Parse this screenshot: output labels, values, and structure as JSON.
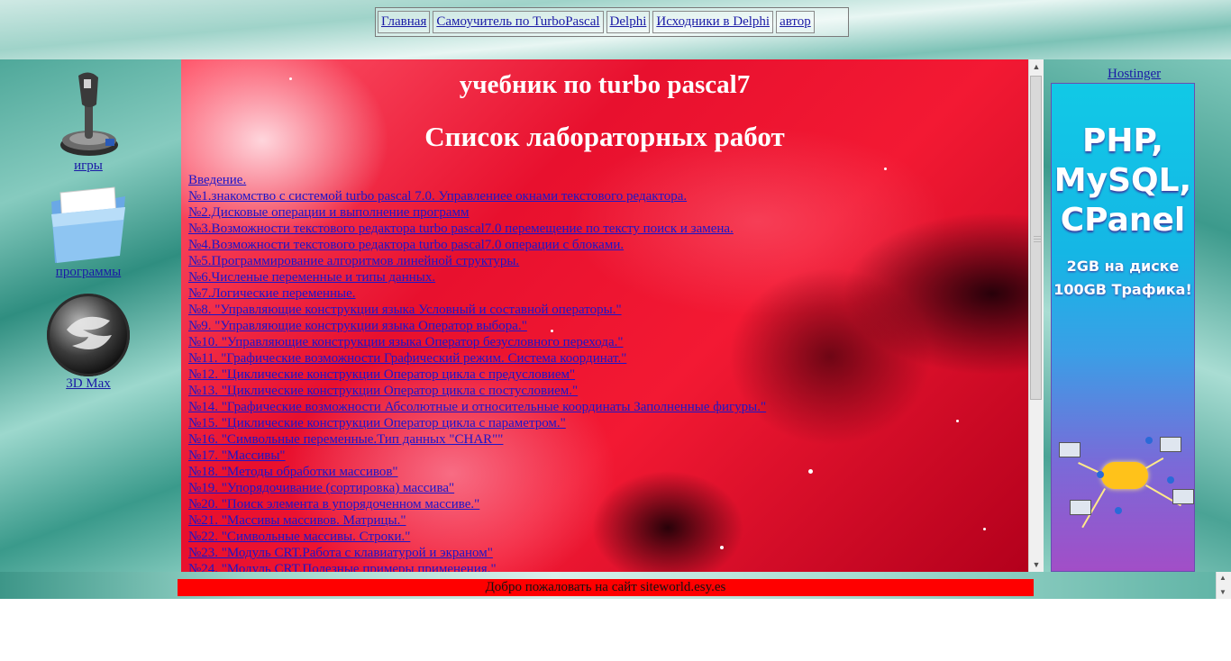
{
  "nav": {
    "items": [
      "Главная",
      "Самоучитель по TurboPascal",
      "Delphi",
      "Исходники в Delphi",
      "автор"
    ]
  },
  "sidebar": {
    "items": [
      {
        "label": "игры",
        "icon": "joystick-icon"
      },
      {
        "label": "программы",
        "icon": "folder-icon"
      },
      {
        "label": "3D Max",
        "icon": "3dmax-logo-icon"
      }
    ]
  },
  "main": {
    "title": "учебник по turbo pascal7",
    "subtitle": "Список лабораторных работ",
    "labs": [
      "Введение.",
      "№1.знакомство с системой turbo pascal 7.0. Управлениее окнами текстового редактора.",
      "№2.Дисковые операции и выполнение программ",
      "№3.Возможности текстового редактора turbo pascal7.0 перемещение по тексту поиск и замена.",
      "№4.Возможности текстового редактора turbo pascal7.0 операции с блоками.",
      "№5.Программирование алгоритмов линейной структуры.",
      "№6.Численые переменные и типы данных.",
      "№7.Логические переменные.",
      "№8. \"Управляющие конструкции языка Условный и составной операторы.\"",
      "№9. \"Управляющие конструкции языка Оператор выбора.\"",
      "№10. \"Управляющие конструкции языка Оператор безусловного перехода.\"",
      "№11. \"Графические возможности Графический режим. Система координат.\"",
      "№12. \"Циклические конструкции Оператор цикла с предусловием\"",
      "№13. \"Циклические конструкции Оператор цикла с постусловием.\"",
      "№14. \"Графические возможности Абсолютные и относительные координаты Заполненные фигуры.\"",
      "№15. \"Циклические конструкции Оператор цикла с параметром.\"",
      "№16. \"Символьные переменные.Тип данных \"CHAR\"\"",
      "№17. \"Массивы\"",
      "№18. \"Методы обработки массивов\"",
      "№19. \"Упорядочивание (сортировка) массива\"",
      "№20. \"Поиск элемента в упорядоченном массиве.\"",
      "№21. \"Массивы массивов. Матрицы.\"",
      "№22. \"Символьные массивы. Строки.\"",
      "№23. \"Модуль CRT.Работа с клавиатурой и экраном\"",
      "№24. \"Модуль CRT.Полезные примеры применения.\""
    ]
  },
  "ad": {
    "link": "Hostinger",
    "headline": [
      "PHP,",
      "MySQL,",
      "CPanel"
    ],
    "line1": "2GB на диске",
    "line2": "100GB Трафика!"
  },
  "footer": {
    "text": "Добро пожаловать на сайт siteworld.esy.es"
  }
}
